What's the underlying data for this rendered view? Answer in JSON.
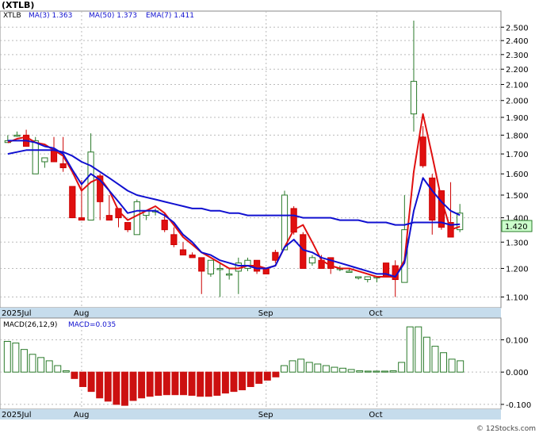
{
  "ticker": "(XTLB)",
  "price_legend": {
    "symbol": "XTLB",
    "ma3": "MA(3)  1.363",
    "ma50": "MA(50)  1.373",
    "ema7": "EMA(7)  1.411"
  },
  "last_price_label": "1.420",
  "macd_legend": {
    "params": "MACD(26,12,9)",
    "value": "MACD=0.035"
  },
  "watermark": "© 12Stocks.com",
  "colors": {
    "up": "#ffffff",
    "down": "#e01010",
    "ma_blue": "#1010d0",
    "ma_red": "#e01010",
    "hist_pos": "#2a7a2a",
    "hist_neg": "#cc1010",
    "axis_bg": "#c6dcec"
  },
  "chart_data": [
    {
      "type": "candlestick",
      "title": "(XTLB)",
      "x_ticks": [
        "2025Jul",
        "Aug",
        "Sep",
        "Oct"
      ],
      "y_ticks": [
        "2.500",
        "2.400",
        "2.300",
        "2.200",
        "2.100",
        "2.000",
        "1.900",
        "1.800",
        "1.700",
        "1.600",
        "1.500",
        "1.400",
        "1.300",
        "1.200",
        "1.100"
      ],
      "ylim": [
        1.07,
        2.6
      ],
      "log_scale": true,
      "grid": true,
      "candles": [
        {
          "label": "2025Jul",
          "o": 1.76,
          "h": 1.8,
          "l": 1.76,
          "c": 1.77
        },
        {
          "o": 1.8,
          "h": 1.82,
          "l": 1.79,
          "c": 1.8
        },
        {
          "o": 1.8,
          "h": 1.83,
          "l": 1.74,
          "c": 1.74
        },
        {
          "o": 1.6,
          "h": 1.79,
          "l": 1.6,
          "c": 1.77
        },
        {
          "o": 1.66,
          "h": 1.68,
          "l": 1.63,
          "c": 1.68
        },
        {
          "o": 1.72,
          "h": 1.79,
          "l": 1.66,
          "c": 1.66
        },
        {
          "o": 1.65,
          "h": 1.79,
          "l": 1.61,
          "c": 1.63
        },
        {
          "o": 1.54,
          "h": 1.54,
          "l": 1.4,
          "c": 1.4
        },
        {
          "label": "Aug",
          "o": 1.4,
          "h": 1.57,
          "l": 1.39,
          "c": 1.39
        },
        {
          "o": 1.39,
          "h": 1.81,
          "l": 1.39,
          "c": 1.71
        },
        {
          "o": 1.59,
          "h": 1.6,
          "l": 1.39,
          "c": 1.47
        },
        {
          "o": 1.41,
          "h": 1.5,
          "l": 1.39,
          "c": 1.39
        },
        {
          "o": 1.44,
          "h": 1.44,
          "l": 1.36,
          "c": 1.4
        },
        {
          "o": 1.38,
          "h": 1.38,
          "l": 1.34,
          "c": 1.35
        },
        {
          "o": 1.33,
          "h": 1.48,
          "l": 1.33,
          "c": 1.47
        },
        {
          "o": 1.41,
          "h": 1.43,
          "l": 1.39,
          "c": 1.43
        },
        {
          "o": 1.43,
          "h": 1.44,
          "l": 1.41,
          "c": 1.43
        },
        {
          "o": 1.39,
          "h": 1.42,
          "l": 1.34,
          "c": 1.35
        },
        {
          "o": 1.33,
          "h": 1.36,
          "l": 1.28,
          "c": 1.29
        },
        {
          "o": 1.27,
          "h": 1.3,
          "l": 1.25,
          "c": 1.25
        },
        {
          "o": 1.25,
          "h": 1.26,
          "l": 1.24,
          "c": 1.24
        },
        {
          "o": 1.24,
          "h": 1.24,
          "l": 1.11,
          "c": 1.19
        },
        {
          "o": 1.18,
          "h": 1.21,
          "l": 1.17,
          "c": 1.23
        },
        {
          "o": 1.2,
          "h": 1.22,
          "l": 1.1,
          "c": 1.2
        },
        {
          "o": 1.18,
          "h": 1.2,
          "l": 1.16,
          "c": 1.18
        },
        {
          "o": 1.19,
          "h": 1.24,
          "l": 1.11,
          "c": 1.22
        },
        {
          "o": 1.2,
          "h": 1.24,
          "l": 1.19,
          "c": 1.23
        },
        {
          "o": 1.23,
          "h": 1.23,
          "l": 1.18,
          "c": 1.19
        },
        {
          "label": "Sep",
          "o": 1.2,
          "h": 1.2,
          "l": 1.18,
          "c": 1.18
        },
        {
          "o": 1.26,
          "h": 1.27,
          "l": 1.22,
          "c": 1.23
        },
        {
          "o": 1.27,
          "h": 1.52,
          "l": 1.27,
          "c": 1.5
        },
        {
          "o": 1.44,
          "h": 1.45,
          "l": 1.33,
          "c": 1.34
        },
        {
          "o": 1.33,
          "h": 1.34,
          "l": 1.2,
          "c": 1.2
        },
        {
          "o": 1.22,
          "h": 1.25,
          "l": 1.21,
          "c": 1.24
        },
        {
          "o": 1.23,
          "h": 1.25,
          "l": 1.2,
          "c": 1.2
        },
        {
          "o": 1.24,
          "h": 1.24,
          "l": 1.18,
          "c": 1.2
        },
        {
          "o": 1.2,
          "h": 1.21,
          "l": 1.19,
          "c": 1.2
        },
        {
          "o": 1.19,
          "h": 1.2,
          "l": 1.19,
          "c": 1.19
        },
        {
          "o": 1.17,
          "h": 1.17,
          "l": 1.16,
          "c": 1.17
        },
        {
          "o": 1.16,
          "h": 1.17,
          "l": 1.15,
          "c": 1.17
        },
        {
          "label": "Oct",
          "o": 1.17,
          "h": 1.17,
          "l": 1.15,
          "c": 1.17
        },
        {
          "o": 1.22,
          "h": 1.22,
          "l": 1.17,
          "c": 1.17
        },
        {
          "o": 1.21,
          "h": 1.23,
          "l": 1.1,
          "c": 1.16
        },
        {
          "o": 1.15,
          "h": 1.5,
          "l": 1.15,
          "c": 1.35
        },
        {
          "o": 1.92,
          "h": 2.55,
          "l": 1.82,
          "c": 2.12
        },
        {
          "o": 1.79,
          "h": 1.85,
          "l": 1.63,
          "c": 1.64
        },
        {
          "o": 1.58,
          "h": 1.6,
          "l": 1.33,
          "c": 1.39
        },
        {
          "o": 1.52,
          "h": 1.52,
          "l": 1.35,
          "c": 1.36
        },
        {
          "o": 1.38,
          "h": 1.56,
          "l": 1.32,
          "c": 1.32
        },
        {
          "o": 1.35,
          "h": 1.46,
          "l": 1.34,
          "c": 1.42
        }
      ],
      "series": [
        {
          "name": "MA(3)",
          "values": [
            1.76,
            1.78,
            1.79,
            1.76,
            1.75,
            1.72,
            1.69,
            1.61,
            1.52,
            1.56,
            1.58,
            1.52,
            1.43,
            1.39,
            1.41,
            1.43,
            1.45,
            1.42,
            1.37,
            1.32,
            1.29,
            1.26,
            1.24,
            1.22,
            1.2,
            1.2,
            1.21,
            1.21,
            1.2,
            1.21,
            1.28,
            1.35,
            1.37,
            1.3,
            1.23,
            1.21,
            1.2,
            1.2,
            1.19,
            1.18,
            1.17,
            1.17,
            1.17,
            1.23,
            1.61,
            1.92,
            1.69,
            1.48,
            1.35,
            1.363
          ]
        },
        {
          "name": "MA(50)",
          "values": [
            1.7,
            1.71,
            1.72,
            1.72,
            1.72,
            1.72,
            1.71,
            1.69,
            1.66,
            1.64,
            1.61,
            1.58,
            1.55,
            1.52,
            1.5,
            1.49,
            1.48,
            1.47,
            1.46,
            1.45,
            1.44,
            1.44,
            1.43,
            1.43,
            1.42,
            1.42,
            1.41,
            1.41,
            1.41,
            1.41,
            1.41,
            1.41,
            1.4,
            1.4,
            1.4,
            1.4,
            1.39,
            1.39,
            1.39,
            1.38,
            1.38,
            1.38,
            1.37,
            1.37,
            1.38,
            1.38,
            1.38,
            1.38,
            1.37,
            1.373
          ]
        },
        {
          "name": "EMA(7)",
          "values": [
            1.77,
            1.77,
            1.77,
            1.76,
            1.74,
            1.73,
            1.7,
            1.62,
            1.55,
            1.6,
            1.57,
            1.52,
            1.47,
            1.42,
            1.43,
            1.43,
            1.43,
            1.41,
            1.38,
            1.33,
            1.3,
            1.26,
            1.25,
            1.23,
            1.22,
            1.21,
            1.21,
            1.2,
            1.2,
            1.21,
            1.28,
            1.31,
            1.27,
            1.26,
            1.24,
            1.23,
            1.22,
            1.21,
            1.2,
            1.19,
            1.18,
            1.18,
            1.17,
            1.22,
            1.43,
            1.58,
            1.52,
            1.47,
            1.43,
            1.411
          ]
        }
      ]
    },
    {
      "type": "bar",
      "title": "MACD(26,12,9)",
      "x_ticks": [
        "2025Jul",
        "Aug",
        "Sep",
        "Oct"
      ],
      "y_ticks": [
        "0.100",
        "0.000",
        "-0.100"
      ],
      "ylim": [
        -0.11,
        0.16
      ],
      "values": [
        0.095,
        0.09,
        0.07,
        0.055,
        0.045,
        0.035,
        0.02,
        0.004,
        -0.02,
        -0.045,
        -0.06,
        -0.08,
        -0.09,
        -0.1,
        -0.103,
        -0.088,
        -0.08,
        -0.075,
        -0.072,
        -0.07,
        -0.07,
        -0.07,
        -0.072,
        -0.075,
        -0.075,
        -0.072,
        -0.065,
        -0.06,
        -0.055,
        -0.045,
        -0.035,
        -0.025,
        -0.015,
        0.02,
        0.035,
        0.04,
        0.03,
        0.025,
        0.02,
        0.015,
        0.012,
        0.008,
        0.004,
        0.003,
        0.003,
        0.003,
        0.004,
        0.03,
        0.14,
        0.14,
        0.108,
        0.08,
        0.06,
        0.04,
        0.035
      ]
    }
  ]
}
